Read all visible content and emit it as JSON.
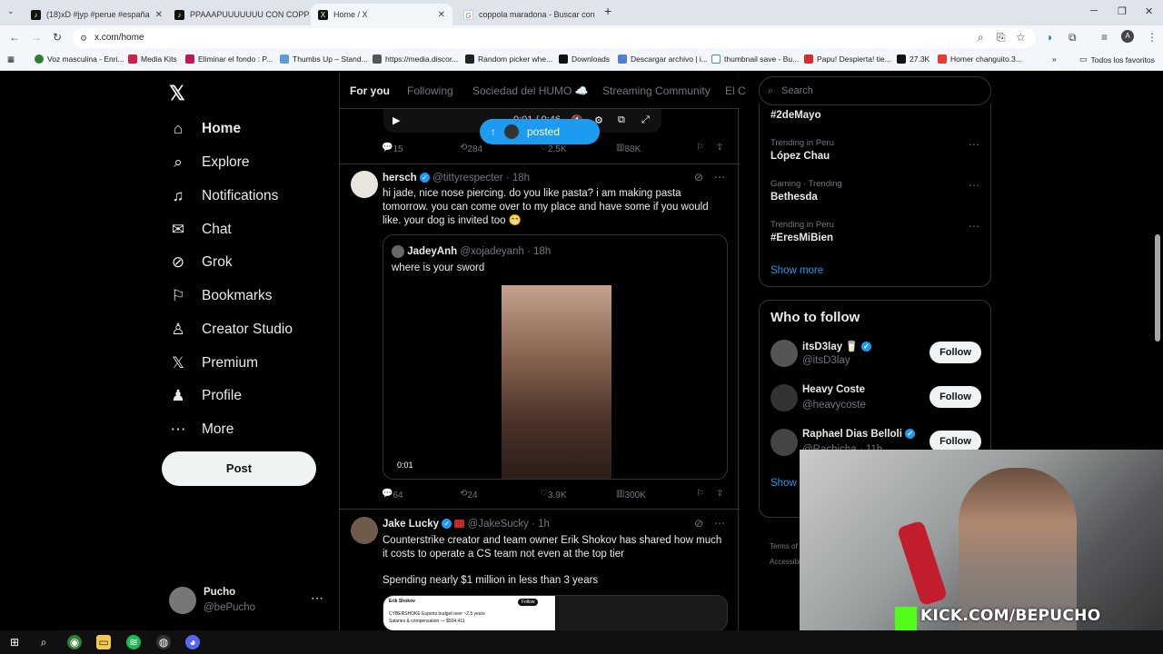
{
  "browser": {
    "tabs": [
      {
        "title": "(18)xD #jyp #perue #españa",
        "icon": "tiktok-icon"
      },
      {
        "title": "PPAAAPUUUUUUU CON COPPO",
        "icon": "tiktok-icon"
      },
      {
        "title": "Home / X",
        "icon": "x-icon"
      },
      {
        "title": "coppola maradona - Buscar con",
        "icon": "google-icon"
      }
    ],
    "url": "x.com/home",
    "bookmarks": [
      "Voz masculina - Enri...",
      "Media Kits",
      "Eliminar el fondo : P...",
      "Thumbs Up – Stand...",
      "https://media.discor...",
      "Random picker whe...",
      "Downloads",
      "Descargar archivo | i...",
      "thumbnail save - Bu...",
      "Papu! Despierta! tie...",
      "27.3K",
      "Homer changuito.3...",
      "Todos los favoritos"
    ]
  },
  "nav": {
    "items": [
      {
        "label": "Home",
        "icon": "home-icon"
      },
      {
        "label": "Explore",
        "icon": "search-icon"
      },
      {
        "label": "Notifications",
        "icon": "bell-icon"
      },
      {
        "label": "Chat",
        "icon": "mail-icon"
      },
      {
        "label": "Grok",
        "icon": "grok-icon"
      },
      {
        "label": "Bookmarks",
        "icon": "bookmark-icon"
      },
      {
        "label": "Creator Studio",
        "icon": "creator-icon"
      },
      {
        "label": "Premium",
        "icon": "x-icon"
      },
      {
        "label": "Profile",
        "icon": "person-icon"
      },
      {
        "label": "More",
        "icon": "more-circle-icon"
      }
    ],
    "post_label": "Post",
    "me": {
      "name": "Pucho",
      "handle": "@bePucho"
    }
  },
  "feed": {
    "tabs": [
      "For you",
      "Following",
      "Sociedad del HUMO ☁️",
      "Streaming Community",
      "El C"
    ],
    "video_time": "0:01 / 0:46",
    "posted_pill": "posted",
    "post0_actions": {
      "replies": "15",
      "reposts": "284",
      "likes": "2.5K",
      "views": "88K"
    },
    "post1": {
      "name": "hersch",
      "handle": "@tittyrespecter",
      "time": "· 18h",
      "text": "hi jade, nice nose piercing. do you like pasta? i am making pasta tomorrow. you can come over to my place and have some if you would like. your dog is invited too 😁",
      "quote": {
        "name": "JadeyAnh",
        "handle": "@xojadeyanh",
        "time": "· 18h",
        "text": "where is your sword",
        "video_time": "0:01"
      },
      "actions": {
        "replies": "64",
        "reposts": "24",
        "likes": "3.9K",
        "views": "300K"
      }
    },
    "post2": {
      "name": "Jake Lucky",
      "handle": "@JakeSucky",
      "time": "· 1h",
      "text": "Counterstrike creator and team owner Erik Shokov has shared how much it costs to operate a CS team not even at the top tier",
      "text2": "Spending nearly $1 million in less than 3 years",
      "media_name": "Erik Shokov",
      "media_follow": "Follow",
      "media_line1": "CYBERSHOKE Esports budget over ~2.5 years",
      "media_line2": "Salaries & compensation — $504,411"
    }
  },
  "right": {
    "search_placeholder": "Search",
    "trends": [
      {
        "label": "",
        "name": "#2deMayo"
      },
      {
        "label": "Trending in Peru",
        "name": "López Chau"
      },
      {
        "label": "Gaming · Trending",
        "name": "Bethesda"
      },
      {
        "label": "Trending in Peru",
        "name": "#EresMiBien"
      }
    ],
    "show_more": "Show more",
    "who_to_follow": "Who to follow",
    "suggestions": [
      {
        "name": "itsD3lay 🥛",
        "handle": "@itsD3lay"
      },
      {
        "name": "Heavy Coste",
        "handle": "@heavycoste"
      },
      {
        "name": "Raphael Dias Belloli",
        "handle": "@Rachicha · 11h"
      }
    ],
    "follow_label": "Follow",
    "show_more2": "Show m",
    "footer1": "Terms of S",
    "footer2": "Accessibi"
  },
  "webcam": {
    "overlay_text": "KICK.COM/BEPUCHO"
  }
}
